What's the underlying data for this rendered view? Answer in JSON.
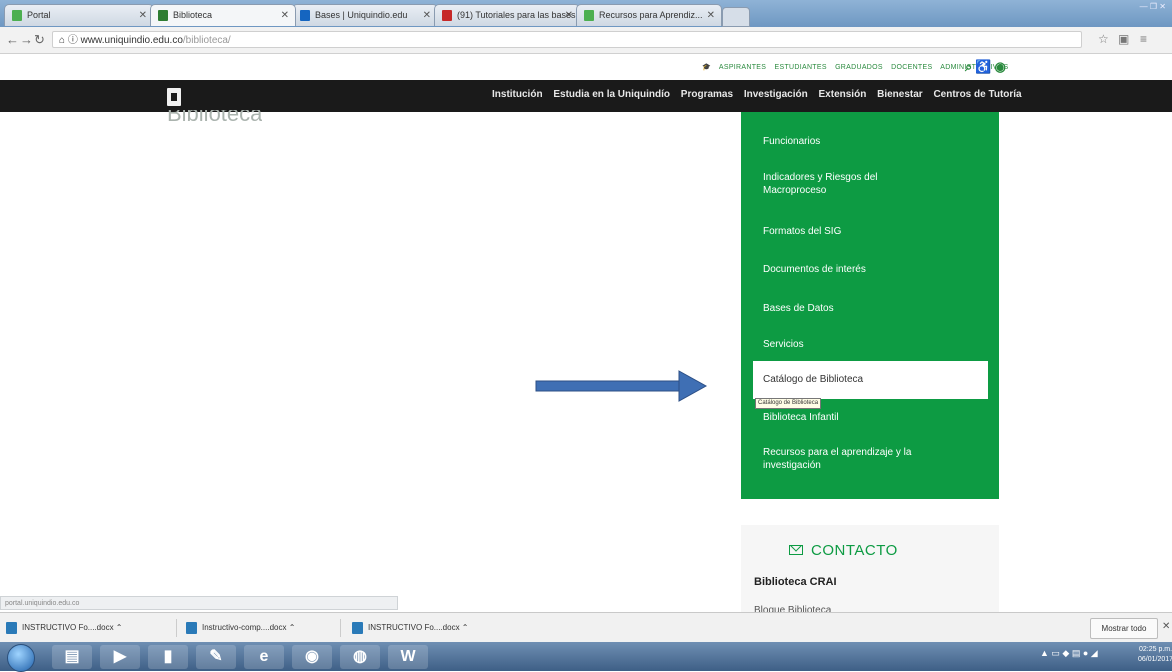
{
  "browser": {
    "tabs": [
      {
        "label": "Portal"
      },
      {
        "label": "Biblioteca"
      },
      {
        "label": "Bases | Uniquindio.edu"
      },
      {
        "label": "(91) Tutoriales para las bases"
      },
      {
        "label": "Recursos para Aprendiz..."
      }
    ],
    "url_domain": "www.uniquindio.edu.co",
    "url_path": "/biblioteca/"
  },
  "utility_bar": {
    "links": [
      "ASPIRANTES",
      "ESTUDIANTES",
      "GRADUADOS",
      "DOCENTES",
      "ADMINISTRATIVOS"
    ]
  },
  "main_nav": {
    "items": [
      "Institución",
      "Estudia en la Uniquindío",
      "Programas",
      "Investigación",
      "Extensión",
      "Bienestar",
      "Centros de Tutoría"
    ]
  },
  "page": {
    "heading": "Biblioteca"
  },
  "side_menu": {
    "items": [
      "Funcionarios",
      "Indicadores y Riesgos del Macroproceso",
      "Formatos del SIG",
      "Documentos de interés",
      "Bases de Datos",
      "Servicios",
      "Catálogo de Biblioteca",
      "Biblioteca Infantil",
      "Recursos para el aprendizaje y la investigación"
    ],
    "tooltip": "Catálogo de Biblioteca",
    "highlight_color": "#0d9b43"
  },
  "contact": {
    "title": "CONTACTO",
    "name": "Biblioteca CRAI",
    "sub": "Bloque Biblioteca"
  },
  "status_url": "portal.uniquindio.edu.co",
  "downloads": {
    "items": [
      "INSTRUCTIVO Fo....docx",
      "Instructivo-comp....docx",
      "INSTRUCTIVO Fo....docx"
    ],
    "show_all": "Mostrar todo"
  },
  "taskbar": {
    "clock_time": "02:25 p.m.",
    "clock_date": "06/01/2017"
  }
}
